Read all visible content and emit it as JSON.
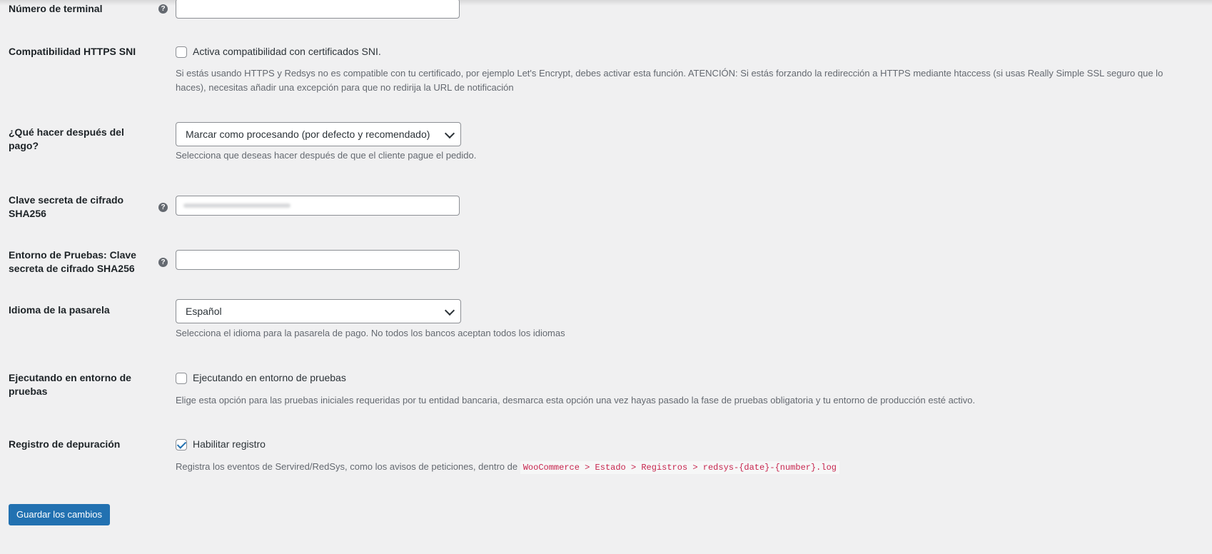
{
  "fields": {
    "terminal": {
      "label": "Número de terminal",
      "help": "?"
    },
    "https_sni": {
      "label": "Compatibilidad HTTPS SNI",
      "checkbox_label": "Activa compatibilidad con certificados SNI.",
      "checked": false,
      "description_line1": "Si estás usando HTTPS y Redsys no es compatible con tu certificado, por ejemplo Let's Encrypt, debes activar esta función. ATENCIÓN: Si estás forzando la redirección a HTTPS mediante htaccess (si usas Really Simple SSL seguro que lo",
      "description_line2": "haces), necesitas añadir una excepción para que no redirija la URL de notificación"
    },
    "after_payment": {
      "label": "¿Qué hacer después del pago?",
      "selected": "Marcar como procesando (por defecto y recomendado)",
      "description": "Selecciona que deseas hacer después de que el cliente pague el pedido."
    },
    "secret_key": {
      "label_line1": "Clave secreta de cifrado",
      "label_line2": "SHA256",
      "help": "?",
      "value": ""
    },
    "test_secret_key": {
      "label_line1": "Entorno de Pruebas: Clave",
      "label_line2": "secreta de cifrado SHA256",
      "help": "?",
      "value": ""
    },
    "language": {
      "label": "Idioma de la pasarela",
      "selected": "Español",
      "description": "Selecciona el idioma para la pasarela de pago. No todos los bancos aceptan todos los idiomas"
    },
    "test_mode": {
      "label_line1": "Ejecutando en entorno de",
      "label_line2": "pruebas",
      "checkbox_label": "Ejecutando en entorno de pruebas",
      "checked": false,
      "description": "Elige esta opción para las pruebas iniciales requeridas por tu entidad bancaria, desmarca esta opción una vez hayas pasado la fase de pruebas obligatoria y tu entorno de producción esté activo."
    },
    "debug_log": {
      "label": "Registro de depuración",
      "checkbox_label": "Habilitar registro",
      "checked": true,
      "description_prefix": "Registra los eventos de Servired/RedSys, como los avisos de peticiones, dentro de",
      "description_code": "WooCommerce > Estado > Registros > redsys-{date}-{number}.log"
    }
  },
  "save_button": "Guardar los cambios",
  "colors": {
    "primary": "#2271b1",
    "background": "#f0f0f1",
    "code_text": "#c7254e"
  }
}
